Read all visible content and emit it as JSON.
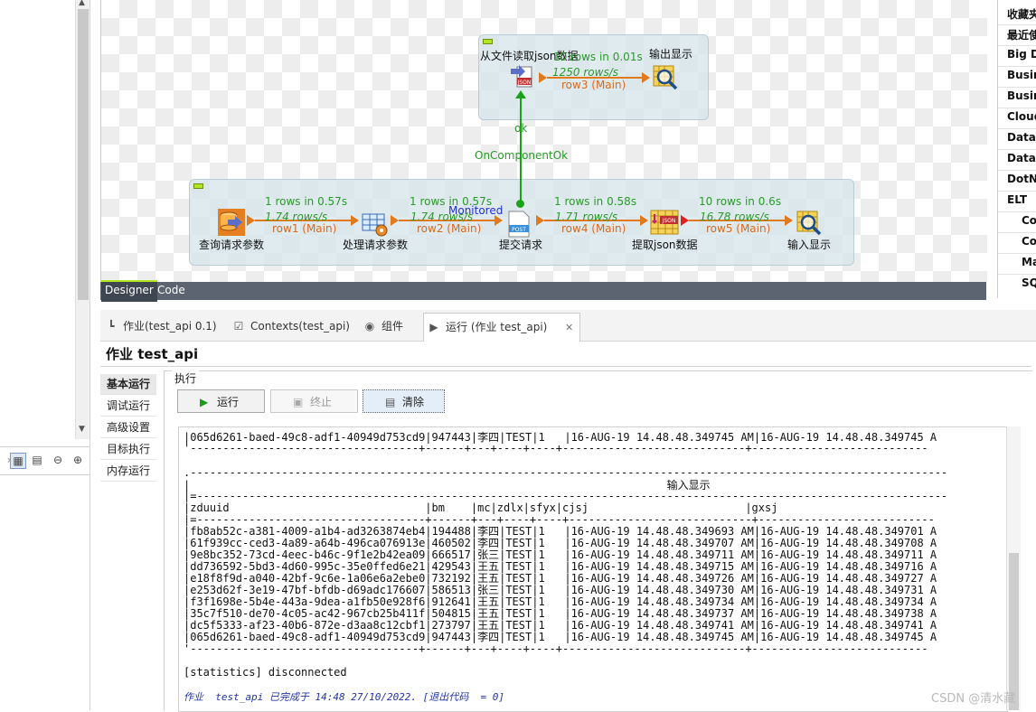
{
  "designer": {
    "subjob_top": {
      "components": {
        "file_read": "从文件读取json数据",
        "output_top": "输出显示"
      },
      "link": {
        "stat1": "10 rows in 0.01s",
        "stat2": "1250 rows/s",
        "label": "row3 (Main)"
      }
    },
    "trigger": {
      "ok": "ok",
      "label": "OnComponentOk"
    },
    "monitored": "Monitored",
    "subjob_bottom": {
      "components": {
        "query_params": "查询请求参数",
        "process_params": "处理请求参数",
        "submit": "提交请求",
        "extract_json": "提取json数据",
        "input_display": "输入显示"
      },
      "links": [
        {
          "stat1": "1 rows in 0.57s",
          "stat2": "1.74 rows/s",
          "label": "row1 (Main)"
        },
        {
          "stat1": "1 rows in 0.57s",
          "stat2": "1.74 rows/s",
          "label": "row2 (Main)"
        },
        {
          "stat1": "1 rows in 0.58s",
          "stat2": "1.71 rows/s",
          "label": "row4 (Main)"
        },
        {
          "stat1": "10 rows in 0.6s",
          "stat2": "16.78 rows/s",
          "label": "row5 (Main)"
        }
      ]
    },
    "tabs": {
      "designer": "Designer",
      "code": "Code"
    }
  },
  "palette": {
    "items": [
      "收藏夹",
      "最近使",
      "Big D",
      "Busin",
      "Busin",
      "Cloud",
      "Data",
      "DataI",
      "DotN",
      "ELT",
      "Co",
      "Co",
      "Ma",
      "SQ"
    ]
  },
  "panel": {
    "tabs": {
      "job": "作业(test_api 0.1)",
      "contexts": "Contexts(test_api)",
      "components": "组件",
      "run": "运行 (作业 test_api)"
    },
    "job_title": "作业 test_api",
    "side_tabs": [
      "基本运行",
      "调试运行",
      "高级设置",
      "目标执行",
      "内存运行"
    ],
    "exec_label": "执行",
    "buttons": {
      "run": "运行",
      "stop": "终止",
      "clear": "清除"
    }
  },
  "console": {
    "line_top": "|065d6261-baed-49c8-adf1-40949d753cd9|947443|李四|TEST|1   |16-AUG-19 14.48.48.349745 AM|16-AUG-19 14.48.48.349745 A",
    "line_top_sep": "'-----------------------------------+------+---+----+----+----------------------------+---------------------------",
    "box_top": ".--------------------------------------------------------------------------------------------------------------------",
    "title_row": "|                                                                         输入显示",
    "title_sep": "|=-------------------------------------------------------------------------------------------------------------------",
    "header": "|zduuid                              |bm    |mc|zdlx|sfyx|cjsj                        |gxsj",
    "header_sep": "|=-----------------------------------+------+---+----+----+----------------------------+---------------------------",
    "rows": [
      "|fb8ab52c-a381-4009-a1b4-ad3263874eb4|194488|李四|TEST|1   |16-AUG-19 14.48.48.349693 AM|16-AUG-19 14.48.48.349701 A",
      "|61f939cc-ced3-4a89-a64b-496ca076913e|460502|李四|TEST|1   |16-AUG-19 14.48.48.349707 AM|16-AUG-19 14.48.48.349708 A",
      "|9e8bc352-73cd-4eec-b46c-9f1e2b42ea09|666517|张三|TEST|1   |16-AUG-19 14.48.48.349711 AM|16-AUG-19 14.48.48.349711 A",
      "|dd736592-5bd3-4d60-995c-35e0ffed6e21|429543|王五|TEST|1   |16-AUG-19 14.48.48.349715 AM|16-AUG-19 14.48.48.349716 A",
      "|e18f8f9d-a040-42bf-9c6e-1a06e6a2ebe0|732192|王五|TEST|1   |16-AUG-19 14.48.48.349726 AM|16-AUG-19 14.48.48.349727 A",
      "|e253d62f-3e19-47bf-bfdb-d69adc176607|586513|张三|TEST|1   |16-AUG-19 14.48.48.349730 AM|16-AUG-19 14.48.48.349731 A",
      "|f3f1698e-5b4e-443a-9dea-a1fb50e928f6|912641|王五|TEST|1   |16-AUG-19 14.48.48.349734 AM|16-AUG-19 14.48.48.349734 A",
      "|35c7f510-de70-4c05-ac42-967cb25b411f|504815|王五|TEST|1   |16-AUG-19 14.48.48.349737 AM|16-AUG-19 14.48.48.349738 A",
      "|dc5f5333-af23-40b6-872e-d3aa8c12cbf1|273797|王五|TEST|1   |16-AUG-19 14.48.48.349741 AM|16-AUG-19 14.48.48.349741 A",
      "|065d6261-baed-49c8-adf1-40949d753cd9|947443|李四|TEST|1   |16-AUG-19 14.48.48.349745 AM|16-AUG-19 14.48.48.349745 A"
    ],
    "bottom_sep": "'-----------------------------------+------+---+----+----+----------------------------+---------------------------",
    "statistics": "[statistics] disconnected",
    "footer": "作业  test_api 已完成于 14:48 27/10/2022. [退出代码  = 0]"
  },
  "watermark": "CSDN @清水藏"
}
